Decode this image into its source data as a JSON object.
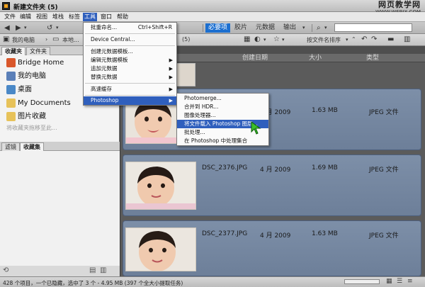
{
  "window": {
    "title": "新建文件夹 (5)",
    "watermark_title": "网页教学网",
    "watermark_url": "WWW.WEBJX.COM"
  },
  "menubar": {
    "items": [
      "文件",
      "编辑",
      "视图",
      "堆栈",
      "标签",
      "工具",
      "窗口",
      "帮助"
    ],
    "active": "工具"
  },
  "toolbar": {
    "workspaces": [
      {
        "label": "必要项",
        "active": true
      },
      {
        "label": "胶片",
        "active": false
      },
      {
        "label": "元数据",
        "active": false
      },
      {
        "label": "输出",
        "active": false
      }
    ]
  },
  "pathbar": {
    "root": "我的电脑",
    "local": "本地...",
    "folder_suffix": "(5)",
    "sort_label": "按文件名排序"
  },
  "left_panel": {
    "top_tabs": [
      "收藏夹",
      "文件夹"
    ],
    "favorites": [
      {
        "label": "Bridge Home",
        "icon": "bridge-home-icon",
        "color": "#d9572b"
      },
      {
        "label": "我的电脑",
        "icon": "computer-icon",
        "color": "#5a7fb8"
      },
      {
        "label": "桌面",
        "icon": "desktop-icon",
        "color": "#4a88c7"
      },
      {
        "label": "My Documents",
        "icon": "folder-icon",
        "color": "#e7c25a"
      },
      {
        "label": "图片收藏",
        "icon": "pictures-folder-icon",
        "color": "#e7c25a"
      }
    ],
    "drop_hint": "将收藏夹拖移至此...",
    "bottom_tabs": [
      "滤镜",
      "收藏集"
    ]
  },
  "columns": {
    "created": "创建日期",
    "size": "大小",
    "type": "类型"
  },
  "files": [
    {
      "name": "",
      "date": "4 月 2009",
      "size": "1.63 MB",
      "type": "JPEG 文件"
    },
    {
      "name": "DSC_2376.JPG",
      "date": "4 月 2009",
      "size": "1.69 MB",
      "type": "JPEG 文件"
    },
    {
      "name": "DSC_2377.JPG",
      "date": "4 月 2009",
      "size": "1.63 MB",
      "type": "JPEG 文件"
    }
  ],
  "tools_menu": {
    "items": [
      {
        "label": "批重命名...",
        "shortcut": "Ctrl+Shift+R",
        "submenu": false
      },
      {
        "label": "Device Central...",
        "shortcut": "",
        "submenu": false
      },
      {
        "label": "创建元数据模板...",
        "shortcut": "",
        "submenu": false
      },
      {
        "label": "编辑元数据模板",
        "shortcut": "",
        "submenu": true
      },
      {
        "label": "追加元数据",
        "shortcut": "",
        "submenu": true
      },
      {
        "label": "替换元数据",
        "shortcut": "",
        "submenu": true
      },
      {
        "label": "高速缓存",
        "shortcut": "",
        "submenu": true
      },
      {
        "label": "Photoshop",
        "shortcut": "",
        "submenu": true
      }
    ]
  },
  "photoshop_menu": {
    "items": [
      {
        "label": "Photomerge..."
      },
      {
        "label": "合并到 HDR..."
      },
      {
        "label": "图像处理器..."
      },
      {
        "label": "将文件载入 Photoshop 图层..."
      },
      {
        "label": "批处理..."
      },
      {
        "label": "在 Photoshop 中处理集合"
      }
    ],
    "highlighted_index": 3
  },
  "statusbar": {
    "text": "428 个项目，一个已隐藏，选中了 3 个 - 4.95 MB (397 个全大小提取任务)"
  },
  "colors": {
    "menu_highlight": "#2f5fbd",
    "workspace_active": "#1c6fd0",
    "row_selected": "#7d8fa8"
  }
}
